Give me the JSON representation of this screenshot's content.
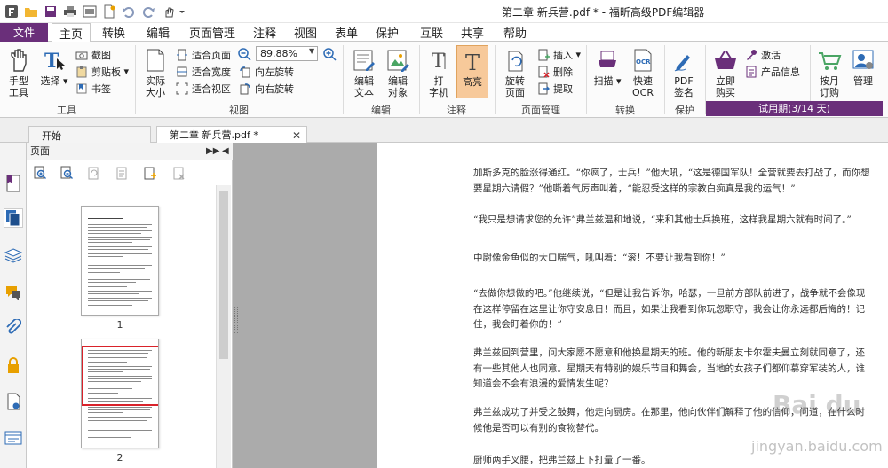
{
  "window": {
    "title": "第二章 新兵营.pdf * - 福昕高级PDF编辑器"
  },
  "menu": {
    "file": "文件",
    "items": [
      "主页",
      "转换",
      "编辑",
      "页面管理",
      "注释",
      "视图",
      "表单",
      "保护",
      "互联",
      "共享",
      "帮助"
    ],
    "active": "主页"
  },
  "ribbon": {
    "tools": {
      "label": "工具",
      "hand": "手型\n工具",
      "select": "选择",
      "snapshot": "截图",
      "clipboard": "剪贴板",
      "bookmark": "书签"
    },
    "view": {
      "label": "视图",
      "actual_size": "实际\n大小",
      "fit_page": "适合页面",
      "fit_width": "适合宽度",
      "fit_visible": "适合视区",
      "zoom": "89.88%",
      "rotate_left": "向左旋转",
      "rotate_right": "向右旋转"
    },
    "edit": {
      "label": "编辑",
      "edit_text": "编辑\n文本",
      "edit_object": "编辑\n对象"
    },
    "comment": {
      "label": "注释",
      "typewriter": "打\n字机",
      "highlight": "高亮"
    },
    "pages": {
      "label": "页面管理",
      "rotate_page": "旋转\n页面",
      "insert": "插入",
      "delete": "删除",
      "extract": "提取"
    },
    "convert": {
      "label": "转换",
      "scan": "扫描",
      "quick_ocr": "快速\nOCR"
    },
    "protect": {
      "label": "保护",
      "pdf_sign": "PDF\n签名"
    },
    "buy": {
      "buy_now": "立即\n购买",
      "activate": "激活",
      "product_info": "产品信息",
      "monthly": "按月\n订购",
      "manage": "管理",
      "trial": "试用期(3/14 天)"
    }
  },
  "tabs": {
    "start": "开始",
    "doc": "第二章 新兵营.pdf *"
  },
  "pages_panel": {
    "title": "页面",
    "page_numbers": [
      "1",
      "2"
    ]
  },
  "document": {
    "paragraphs": [
      "加斯多克的脸涨得通红。“你疯了，士兵！”他大吼，“这是德国军队！全营就要去打战了，而你想要星期六请假？”他嘶着气厉声叫着，“能忍受这样的宗教白痴真是我的运气！”",
      "“我只是想请求您的允许”弗兰兹温和地说，“来和其他士兵换班，这样我星期六就有时间了。”",
      "中尉像金鱼似的大口喘气，吼叫着：“滚！不要让我看到你！”",
      "“去做你想做的吧。”他继续说，“但是让我告诉你，哈瑟，一旦前方部队前进了，战争就不会像现在这样停留在这里让你守安息日！而且，如果让我看到你玩忽职守，我会让你永远都后悔的！记住，我会盯着你的！”",
      "弗兰兹回到营里，问大家愿不愿意和他换星期天的班。他的新朋友卡尔霍夫曼立刻就同意了，还有一些其他人也同意。星期天有特别的娱乐节目和舞会，当地的女孩子们都仰慕穿军装的人，谁知道会不会有浪漫的爱情发生呢？",
      "弗兰兹成功了并受之鼓舞，他走向厨房。在那里，他向伙伴们解释了他的信仰，问道，在什么时候他是否可以有别的食物替代。",
      "厨师两手叉腰，把弗兰兹上下打量了一番。"
    ]
  },
  "watermark": {
    "brand": "Bai du",
    "url": "jingyan.baidu.com"
  },
  "colors": {
    "accent": "#6a2f7a",
    "selection": "#d9222a"
  }
}
